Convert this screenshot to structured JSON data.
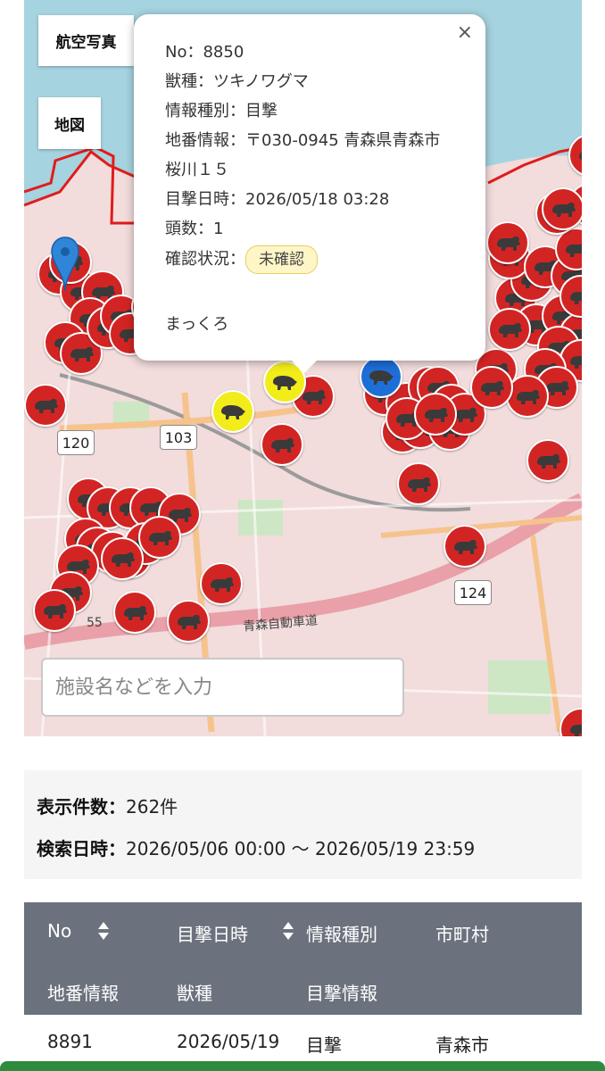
{
  "map": {
    "aerial_label": "航空写真",
    "map_label": "地図",
    "road_labels": [
      "120",
      "103",
      "124",
      "青森自動車道",
      "55"
    ],
    "markers": {
      "bear_count": 70,
      "boar_count": 2,
      "other_count": 1,
      "bear_icon": "bear-icon",
      "boar_icon": "boar-icon"
    },
    "popup": {
      "no_label": "No：",
      "no": "8850",
      "species_label": "獣種：",
      "species": "ツキノワグマ",
      "info_type_label": "情報種別：",
      "info_type": "目撃",
      "address_label": "地番情報：",
      "address_line1": "〒030-0945 青森県青森市",
      "address_line2": "桜川１５",
      "date_label": "目撃日時：",
      "date": "2026/05/18 03:28",
      "count_label": "頭数：",
      "count": "1",
      "status_label": "確認状況：",
      "status": "未確認",
      "note": "まっくろ",
      "close": "×"
    },
    "search_placeholder": "施設名などを入力"
  },
  "summary": {
    "count_label": "表示件数：",
    "count_value": "262件",
    "range_label": "検索日時：",
    "range_value": "2026/05/06 00:00 〜 2026/05/19 23:59"
  },
  "table": {
    "headers": [
      "No",
      "目撃日時",
      "情報種別",
      "市町村",
      "地番情報",
      "獣種",
      "目撃情報"
    ],
    "rows": [
      [
        "8891",
        "2026/05/19",
        "目撃",
        "青森市"
      ]
    ]
  },
  "colors": {
    "bear_marker": "#d32424",
    "boar_marker": "#f2ec1a",
    "header_bg": "#6b727d",
    "accent_green": "#2e8b3e"
  }
}
